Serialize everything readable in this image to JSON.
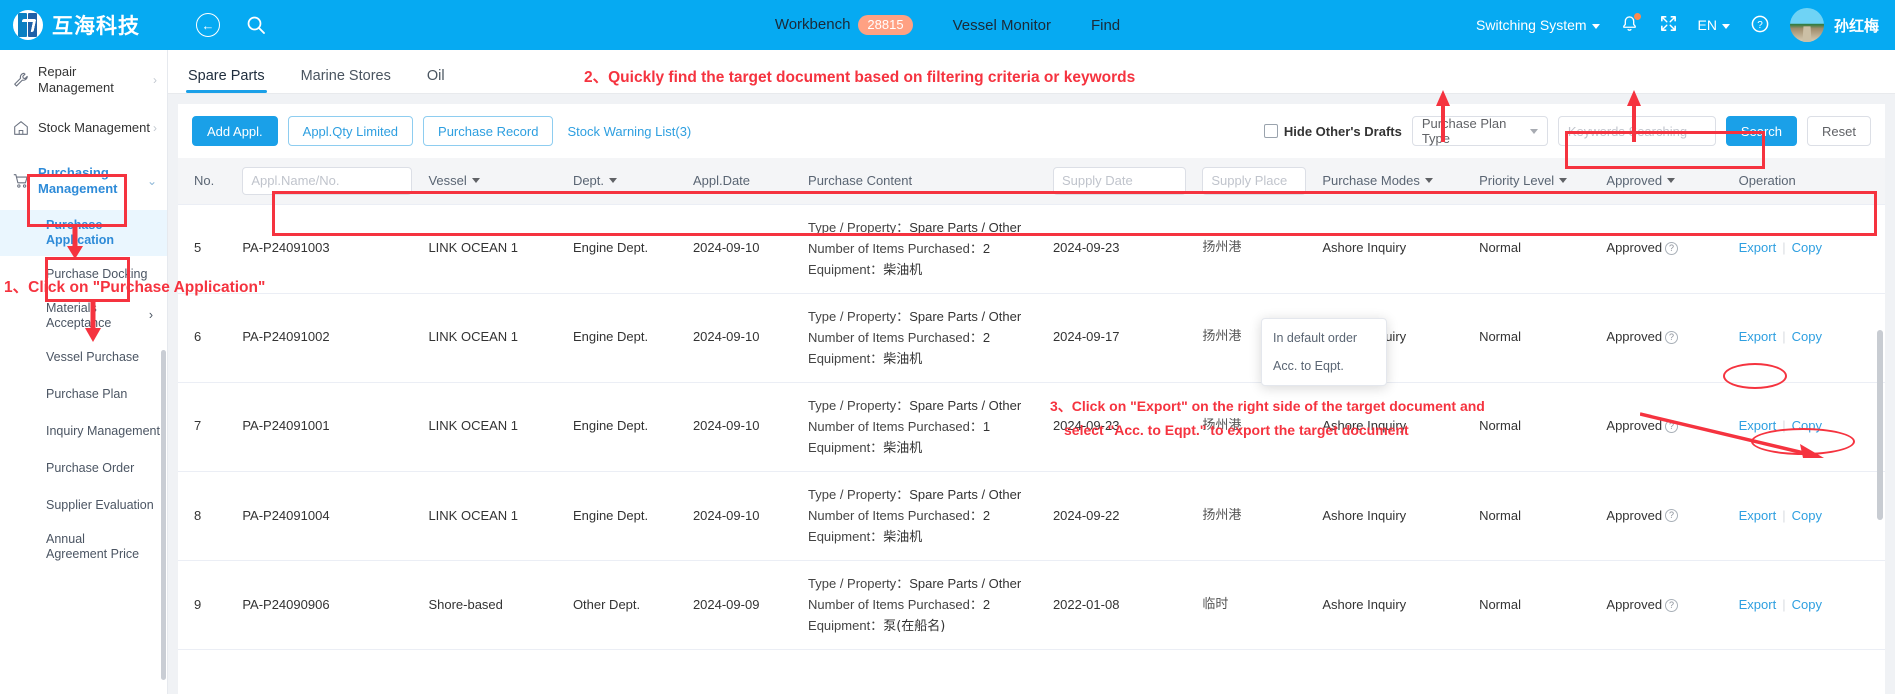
{
  "header": {
    "logo_text": "互海科技",
    "back_icon": "arrow-left-icon",
    "search_icon": "search-icon",
    "nav": [
      {
        "label": "Workbench",
        "badge": "28815"
      },
      {
        "label": "Vessel Monitor",
        "badge": ""
      },
      {
        "label": "Find",
        "badge": ""
      }
    ],
    "switching_system": "Switching System",
    "language": "EN",
    "user_name": "孙红梅",
    "bell_icon": "bell-icon",
    "fullscreen_icon": "fullscreen-icon",
    "help_icon": "question-circle-icon",
    "avatar": "user-avatar"
  },
  "sidebar": {
    "top_items": [
      {
        "label": "Repair Management",
        "icon": "wrench-icon",
        "chevron": "›"
      },
      {
        "label": "Stock Management",
        "icon": "home-icon",
        "chevron": "›"
      },
      {
        "label": "Purchasing Management",
        "icon": "cart-icon",
        "chevron": "⌄"
      }
    ],
    "sub_items": [
      {
        "label": "Purchase Application",
        "selected": true
      },
      {
        "label": "Purchase Docking",
        "selected": false
      },
      {
        "label": "Materials Acceptance",
        "selected": false,
        "chevron": "›"
      },
      {
        "label": "Vessel Purchase",
        "selected": false
      },
      {
        "label": "Purchase Plan",
        "selected": false
      },
      {
        "label": "Inquiry Management",
        "selected": false
      },
      {
        "label": "Purchase Order",
        "selected": false
      },
      {
        "label": "Supplier Evaluation",
        "selected": false
      },
      {
        "label": "Annual Agreement Price",
        "selected": false
      }
    ]
  },
  "tabs": [
    {
      "label": "Spare Parts",
      "active": true
    },
    {
      "label": "Marine Stores",
      "active": false
    },
    {
      "label": "Oil",
      "active": false
    }
  ],
  "toolbar": {
    "add_appl": "Add Appl.",
    "appl_qty_limited": "Appl.Qty Limited",
    "purchase_record": "Purchase Record",
    "stock_warning_list": "Stock Warning List(3)",
    "hide_drafts_label": "Hide Other's Drafts",
    "purchase_plan_type": "Purchase Plan Type",
    "keywords_placeholder": "Keywords Searching",
    "search_label": "Search",
    "reset_label": "Reset"
  },
  "table": {
    "headers": {
      "no": "No.",
      "appl_name_no": "Appl.Name/No.",
      "vessel": "Vessel",
      "dept": "Dept.",
      "appl_date": "Appl.Date",
      "purchase_content": "Purchase Content",
      "supply_date": "Supply Date",
      "supply_place": "Supply Place",
      "purchase_modes": "Purchase Modes",
      "priority_level": "Priority Level",
      "approved": "Approved",
      "operation": "Operation"
    },
    "content_labels": {
      "type_property": "Type / Property：",
      "number_items": "Number of Items Purchased：",
      "equipment": "Equipment："
    },
    "ops": {
      "export": "Export",
      "copy": "Copy",
      "sep": "|"
    },
    "rows": [
      {
        "no": "5",
        "appl_no": "PA-P24091003",
        "vessel": "LINK OCEAN 1",
        "dept": "Engine Dept.",
        "appl_date": "2024-09-10",
        "type_property": "Spare Parts / Other",
        "items": "2",
        "equipment": "柴油机",
        "supply_date": "2024-09-23",
        "supply_place": "扬州港",
        "mode": "Ashore Inquiry",
        "priority": "Normal",
        "approved": "Approved"
      },
      {
        "no": "6",
        "appl_no": "PA-P24091002",
        "vessel": "LINK OCEAN 1",
        "dept": "Engine Dept.",
        "appl_date": "2024-09-10",
        "type_property": "Spare Parts / Other",
        "items": "2",
        "equipment": "柴油机",
        "supply_date": "2024-09-17",
        "supply_place": "扬州港",
        "mode": "Ashore Inquiry",
        "priority": "Normal",
        "approved": "Approved"
      },
      {
        "no": "7",
        "appl_no": "PA-P24091001",
        "vessel": "LINK OCEAN 1",
        "dept": "Engine Dept.",
        "appl_date": "2024-09-10",
        "type_property": "Spare Parts / Other",
        "items": "1",
        "equipment": "柴油机",
        "supply_date": "2024-09-23",
        "supply_place": "扬州港",
        "mode": "Ashore Inquiry",
        "priority": "Normal",
        "approved": "Approved"
      },
      {
        "no": "8",
        "appl_no": "PA-P24091004",
        "vessel": "LINK OCEAN 1",
        "dept": "Engine Dept.",
        "appl_date": "2024-09-10",
        "type_property": "Spare Parts / Other",
        "items": "2",
        "equipment": "柴油机",
        "supply_date": "2024-09-22",
        "supply_place": "扬州港",
        "mode": "Ashore Inquiry",
        "priority": "Normal",
        "approved": "Approved"
      },
      {
        "no": "9",
        "appl_no": "PA-P24090906",
        "vessel": "Shore-based",
        "dept": "Other Dept.",
        "appl_date": "2024-09-09",
        "type_property": "Spare Parts / Other",
        "items": "2",
        "equipment": "泵(在船名)",
        "supply_date": "2022-01-08",
        "supply_place": "临时",
        "mode": "Ashore Inquiry",
        "priority": "Normal",
        "approved": "Approved"
      }
    ]
  },
  "export_menu": {
    "items": [
      "In default order",
      "Acc. to Eqpt."
    ]
  },
  "annotations": {
    "step1": "1、Click on \"Purchase Application\"",
    "step2": "2、Quickly find the target document based on filtering criteria or keywords",
    "step3_line1": "3、Click on \"Export\" on the right side of the target document and",
    "step3_line2": "select \"Acc. to Eqpt.\" to export the target document"
  },
  "colors": {
    "brand": "#06aaf2",
    "accent": "#1aa0e8",
    "annotation_red": "#f5333f",
    "badge": "#ffa183"
  }
}
